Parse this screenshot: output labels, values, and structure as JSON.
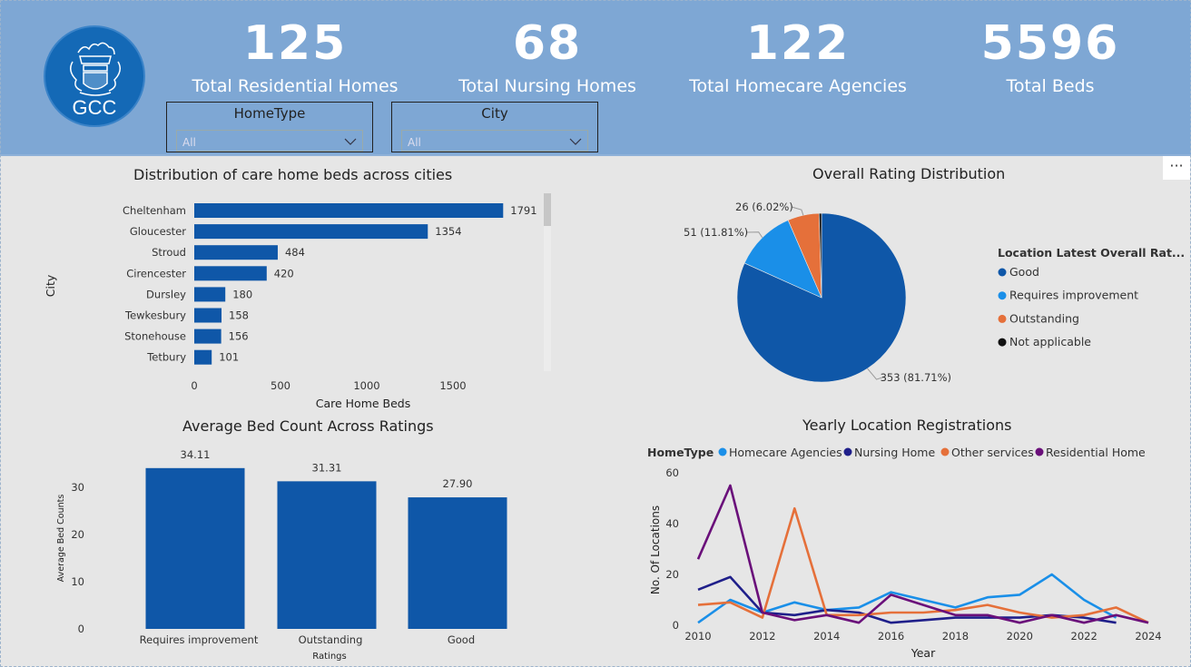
{
  "header": {
    "logo_text": "GCC",
    "kpis": [
      {
        "value": "125",
        "label": "Total Residential Homes"
      },
      {
        "value": "68",
        "label": "Total Nursing Homes"
      },
      {
        "value": "122",
        "label": "Total Homecare Agencies"
      },
      {
        "value": "5596",
        "label": "Total Beds"
      }
    ],
    "slicers": [
      {
        "title": "HomeType",
        "value": "All"
      },
      {
        "title": "City",
        "value": "All"
      }
    ]
  },
  "more_label": "···",
  "chart_data": [
    {
      "type": "bar",
      "orientation": "horizontal",
      "title": "Distribution of care home beds across cities",
      "xlabel": "Care Home Beds",
      "ylabel": "City",
      "categories": [
        "Cheltenham",
        "Gloucester",
        "Stroud",
        "Cirencester",
        "Dursley",
        "Tewkesbury",
        "Stonehouse",
        "Tetbury"
      ],
      "values": [
        1791,
        1354,
        484,
        420,
        180,
        158,
        156,
        101
      ],
      "xticks": [
        0,
        500,
        1000,
        1500
      ],
      "xlim": [
        0,
        2000
      ],
      "color": "#0f57a8"
    },
    {
      "type": "pie",
      "title": "Overall Rating Distribution",
      "legend_title": "Location Latest Overall Rat...",
      "legend_position": "right",
      "slices": [
        {
          "name": "Good",
          "value": 353,
          "label": "353 (81.71%)",
          "color": "#0f57a8"
        },
        {
          "name": "Requires improvement",
          "value": 51,
          "label": "51 (11.81%)",
          "color": "#1a8fe8"
        },
        {
          "name": "Outstanding",
          "value": 26,
          "label": "26 (6.02%)",
          "color": "#e5703a"
        },
        {
          "name": "Not applicable",
          "value": 2,
          "label": "",
          "color": "#111111"
        }
      ]
    },
    {
      "type": "bar",
      "title": "Average Bed Count Across Ratings",
      "xlabel": "Ratings",
      "ylabel": "Average Bed Counts",
      "categories": [
        "Requires improvement",
        "Outstanding",
        "Good"
      ],
      "values": [
        34.11,
        31.31,
        27.9
      ],
      "value_labels": [
        "34.11",
        "31.31",
        "27.90"
      ],
      "yticks": [
        0,
        10,
        20,
        30
      ],
      "ylim": [
        0,
        36
      ],
      "color": "#0f57a8"
    },
    {
      "type": "line",
      "title": "Yearly Location Registrations",
      "legend_title": "HomeType",
      "legend_position": "top",
      "xlabel": "Year",
      "ylabel": "No. Of Locations",
      "xticks": [
        2010,
        2012,
        2014,
        2016,
        2018,
        2020,
        2022,
        2024
      ],
      "yticks": [
        0,
        20,
        40,
        60
      ],
      "xlim": [
        2010,
        2024
      ],
      "ylim": [
        0,
        60
      ],
      "series": [
        {
          "name": "Homecare Agencies",
          "color": "#1a8fe8",
          "x": [
            2010,
            2011,
            2012,
            2013,
            2014,
            2015,
            2016,
            2017,
            2018,
            2019,
            2020,
            2021,
            2022,
            2023
          ],
          "y": [
            1,
            10,
            5,
            9,
            6,
            7,
            13,
            10,
            7,
            11,
            12,
            20,
            10,
            3
          ]
        },
        {
          "name": "Nursing Home",
          "color": "#1f1f8a",
          "x": [
            2010,
            2011,
            2012,
            2013,
            2014,
            2015,
            2016,
            2017,
            2018,
            2019,
            2020,
            2021,
            2022,
            2023
          ],
          "y": [
            14,
            19,
            5,
            4,
            6,
            5,
            1,
            2,
            3,
            3,
            3,
            4,
            3,
            1
          ]
        },
        {
          "name": "Other services",
          "color": "#e5703a",
          "x": [
            2010,
            2011,
            2012,
            2013,
            2014,
            2015,
            2016,
            2017,
            2018,
            2019,
            2020,
            2021,
            2022,
            2023,
            2024
          ],
          "y": [
            8,
            9,
            3,
            46,
            4,
            4,
            5,
            5,
            6,
            8,
            5,
            3,
            4,
            7,
            1
          ]
        },
        {
          "name": "Residential Home",
          "color": "#6a0f7a",
          "x": [
            2010,
            2011,
            2012,
            2013,
            2014,
            2015,
            2016,
            2017,
            2018,
            2019,
            2020,
            2021,
            2022,
            2023,
            2024
          ],
          "y": [
            26,
            55,
            5,
            2,
            4,
            1,
            12,
            8,
            4,
            4,
            1,
            4,
            1,
            4,
            1
          ]
        }
      ]
    }
  ]
}
